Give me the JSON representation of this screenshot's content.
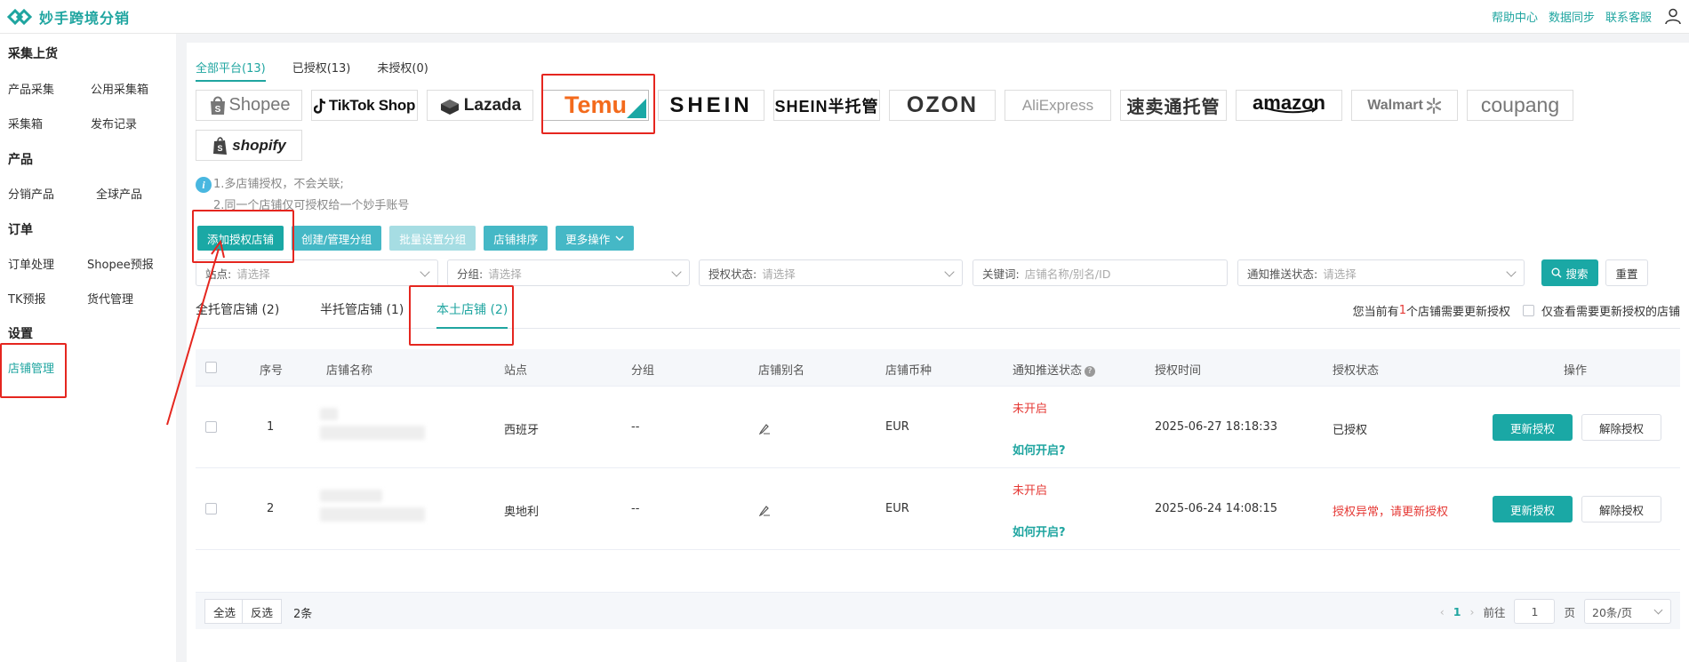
{
  "header": {
    "app_name": "妙手跨境分销",
    "links": [
      "帮助中心",
      "数据同步",
      "联系客服"
    ]
  },
  "sidebar": {
    "groups": [
      {
        "title": "采集上货",
        "items": [
          "产品采集",
          "公用采集箱",
          "采集箱",
          "发布记录"
        ]
      },
      {
        "title": "产品",
        "items": [
          "分销产品",
          "全球产品"
        ]
      },
      {
        "title": "订单",
        "items": [
          "订单处理",
          "Shopee预报",
          "TK预报",
          "货代管理"
        ]
      },
      {
        "title": "设置",
        "items": [
          "店铺管理"
        ]
      }
    ],
    "active": "店铺管理"
  },
  "platform_tabs": [
    "全部平台(13)",
    "已授权(13)",
    "未授权(0)"
  ],
  "platforms": [
    "Shopee",
    "TikTok Shop",
    "Lazada",
    "Temu",
    "SHEIN",
    "SHEIN半托管",
    "OZON",
    "AliExpress",
    "速卖通托管",
    "amazon",
    "Walmart",
    "coupang",
    "shopify"
  ],
  "tips": [
    "1.多店铺授权，不会关联;",
    "2.同一个店铺仅可授权给一个妙手账号"
  ],
  "actions": [
    "添加授权店铺",
    "创建/管理分组",
    "批量设置分组",
    "店铺排序",
    "更多操作"
  ],
  "filters": {
    "site_label": "站点:",
    "group_label": "分组:",
    "auth_label": "授权状态:",
    "keyword_label": "关键词:",
    "push_label": "通知推送状态:",
    "placeholder": "请选择",
    "keyword_placeholder": "店铺名称/别名/ID",
    "search": "搜索",
    "reset": "重置"
  },
  "store_tabs": [
    "全托管店铺 (2)",
    "半托管店铺 (1)",
    "本土店铺 (2)"
  ],
  "notice": {
    "pre": "您当前有",
    "count": "1",
    "post": "个店铺需要更新授权",
    "checkbox_label": "仅查看需要更新授权的店铺"
  },
  "table": {
    "columns": [
      "序号",
      "店铺名称",
      "站点",
      "分组",
      "店铺别名",
      "店铺币种",
      "通知推送状态",
      "授权时间",
      "授权状态",
      "操作"
    ],
    "rows": [
      {
        "index": "1",
        "site": "西班牙",
        "group": "--",
        "currency": "EUR",
        "push_status": "未开启",
        "push_help": "如何开启?",
        "auth_time": "2025-06-27 18:18:33",
        "auth_status": "已授权",
        "auth_error": false
      },
      {
        "index": "2",
        "site": "奥地利",
        "group": "--",
        "currency": "EUR",
        "push_status": "未开启",
        "push_help": "如何开启?",
        "auth_time": "2025-06-24 14:08:15",
        "auth_status": "授权异常，请更新授权",
        "auth_error": true
      }
    ],
    "update_btn": "更新授权",
    "unbind_btn": "解除授权"
  },
  "footer": {
    "select_all": "全选",
    "invert": "反选",
    "count": "2条",
    "current_page": "1",
    "goto_label": "前往",
    "goto_value": "1",
    "page_unit": "页",
    "page_size": "20条/页"
  },
  "colors": {
    "brand": "#1fa5a0",
    "button": "#1aa8a5",
    "danger": "#e53935",
    "annotation": "#e5261f"
  }
}
